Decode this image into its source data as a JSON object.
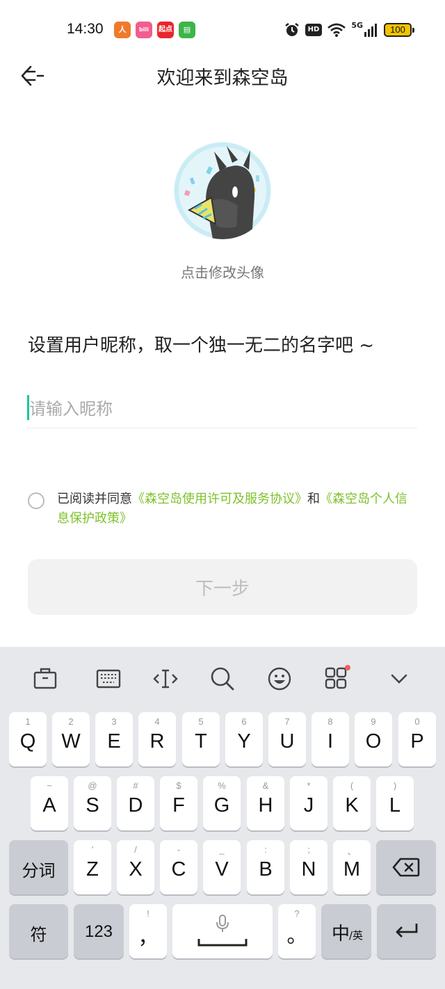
{
  "status_bar": {
    "time": "14:30",
    "apps": [
      {
        "name": "app-icon-orange",
        "color": "#f07a2b",
        "label": "人"
      },
      {
        "name": "app-icon-bilibili",
        "color": "#f25d8e",
        "label": "bili"
      },
      {
        "name": "app-icon-qidian",
        "color": "#e8262d",
        "label": "起点"
      },
      {
        "name": "app-icon-messages",
        "color": "#3cb54a",
        "label": "▤"
      }
    ],
    "network": "5G",
    "hd": "HD",
    "battery": "100"
  },
  "header": {
    "title": "欢迎来到森空岛",
    "back_icon": "back-arrow-icon"
  },
  "avatar": {
    "hint": "点击修改头像"
  },
  "prompt": "设置用户昵称，取一个独一无二的名字吧 ~",
  "nickname_input": {
    "placeholder": "请输入昵称",
    "value": ""
  },
  "agreement": {
    "prefix": "已阅读并同意",
    "link1": "《森空岛使用许可及服务协议》",
    "middle": "和",
    "link2": "《森空岛个人信息保护政策》",
    "checked": false
  },
  "next_button": "下一步",
  "keyboard": {
    "toolbar": [
      "clipboard-icon",
      "keyboard-icon",
      "cursor-move-icon",
      "search-icon",
      "emoji-icon",
      "apps-grid-icon",
      "collapse-icon"
    ],
    "row1": [
      {
        "k": "Q",
        "h": "1"
      },
      {
        "k": "W",
        "h": "2"
      },
      {
        "k": "E",
        "h": "3"
      },
      {
        "k": "R",
        "h": "4"
      },
      {
        "k": "T",
        "h": "5"
      },
      {
        "k": "Y",
        "h": "6"
      },
      {
        "k": "U",
        "h": "7"
      },
      {
        "k": "I",
        "h": "8"
      },
      {
        "k": "O",
        "h": "9"
      },
      {
        "k": "P",
        "h": "0"
      }
    ],
    "row2": [
      {
        "k": "A",
        "h": "~"
      },
      {
        "k": "S",
        "h": "@"
      },
      {
        "k": "D",
        "h": "#"
      },
      {
        "k": "F",
        "h": "$"
      },
      {
        "k": "G",
        "h": "%"
      },
      {
        "k": "H",
        "h": "&"
      },
      {
        "k": "J",
        "h": "*"
      },
      {
        "k": "K",
        "h": "("
      },
      {
        "k": "L",
        "h": ")"
      }
    ],
    "row3": [
      {
        "k": "Z",
        "h": "'"
      },
      {
        "k": "X",
        "h": "/"
      },
      {
        "k": "C",
        "h": "-"
      },
      {
        "k": "V",
        "h": "_"
      },
      {
        "k": "B",
        "h": ":"
      },
      {
        "k": "N",
        "h": ";"
      },
      {
        "k": "M",
        "h": "、"
      }
    ],
    "segment_key": "分词",
    "symbol_key": "符",
    "num_key": "123",
    "comma_key": {
      "k": "，",
      "h": "!"
    },
    "period_key": {
      "k": "。",
      "h": "?"
    },
    "lang_key_main": "中",
    "lang_key_sub": "/英"
  }
}
